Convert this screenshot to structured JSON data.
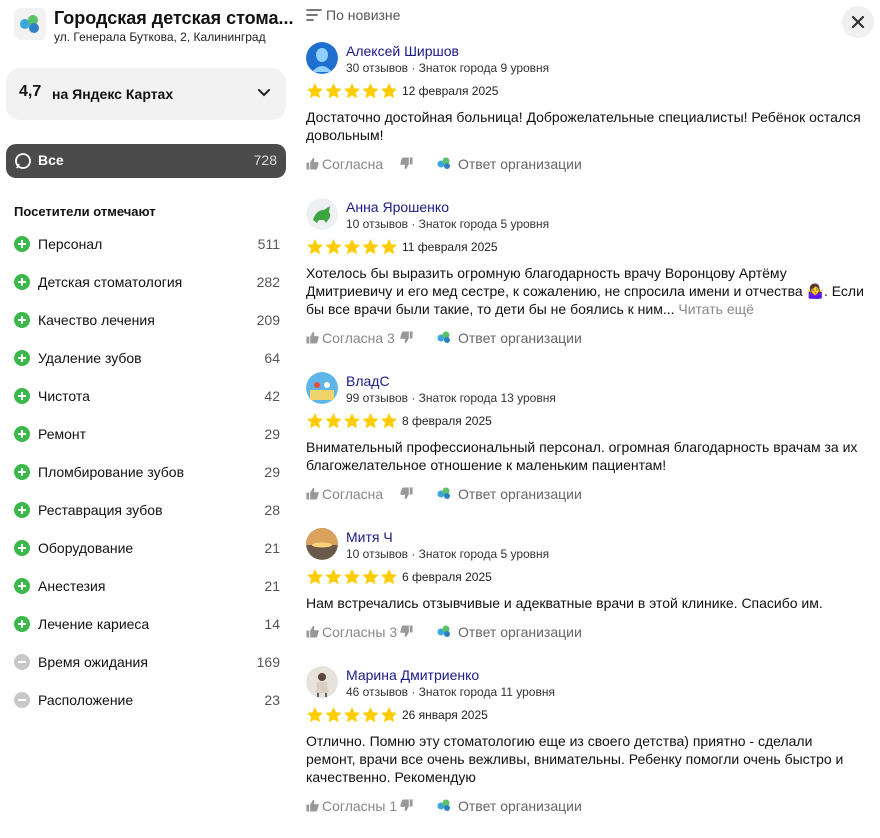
{
  "org": {
    "title": "Городская детская стома...",
    "address": "ул. Генерала Буткова, 2, Калининград"
  },
  "rating": {
    "value": "4,7",
    "source": "на Яндекс Картах"
  },
  "filter_all": {
    "label": "Все",
    "count": "728"
  },
  "visitors_heading": "Посетители отмечают",
  "tags": [
    {
      "label": "Персонал",
      "count": "511",
      "sentiment": "positive"
    },
    {
      "label": "Детская стоматология",
      "count": "282",
      "sentiment": "positive"
    },
    {
      "label": "Качество лечения",
      "count": "209",
      "sentiment": "positive"
    },
    {
      "label": "Удаление зубов",
      "count": "64",
      "sentiment": "positive"
    },
    {
      "label": "Чистота",
      "count": "42",
      "sentiment": "positive"
    },
    {
      "label": "Ремонт",
      "count": "29",
      "sentiment": "positive"
    },
    {
      "label": "Пломбирование зубов",
      "count": "29",
      "sentiment": "positive"
    },
    {
      "label": "Реставрация зубов",
      "count": "28",
      "sentiment": "positive"
    },
    {
      "label": "Оборудование",
      "count": "21",
      "sentiment": "positive"
    },
    {
      "label": "Анестезия",
      "count": "21",
      "sentiment": "positive"
    },
    {
      "label": "Лечение кариеса",
      "count": "14",
      "sentiment": "positive"
    },
    {
      "label": "Время ожидания",
      "count": "169",
      "sentiment": "neutral"
    },
    {
      "label": "Расположение",
      "count": "23",
      "sentiment": "neutral"
    }
  ],
  "sort": {
    "label": "По новизне"
  },
  "reviews": [
    {
      "author": "Алексей Ширшов",
      "meta": "30 отзывов · Знаток города 9 уровня",
      "rating": 5,
      "date": "12 февраля 2025",
      "text_lines": [
        "Достаточно достойная больница! Доброжелательные специалисты! Ребёнок остался",
        "довольным!"
      ],
      "agree": "Согласна",
      "reply": "Ответ организации"
    },
    {
      "author": "Анна Ярошенко",
      "meta": "10 отзывов · Знаток города 5 уровня",
      "rating": 5,
      "date": "11 февраля 2025",
      "text_lines": [
        "Хотелось бы выразить огромную благодарность врачу Воронцову Артёму",
        "Дмитриевичу и его мед сестре, к сожалению, не спросила имени и отчества 🤷‍♀️. Если",
        "бы все врачи были такие, то дети бы не боялись к ним..."
      ],
      "read_more": "Читать ещё",
      "agree": "Согласна 3",
      "reply": "Ответ организации"
    },
    {
      "author": "ВладС",
      "meta": "99 отзывов · Знаток города 13 уровня",
      "rating": 5,
      "date": "8 февраля 2025",
      "text_lines": [
        "Внимательный профессиональный персонал. огромная благодарность врачам за их",
        "благожелательное отношение к маленьким пациентам!"
      ],
      "agree": "Согласна",
      "reply": "Ответ организации"
    },
    {
      "author": "Митя Ч",
      "meta": "10 отзывов · Знаток города 5 уровня",
      "rating": 5,
      "date": "6 февраля 2025",
      "text_lines": [
        "Нам встречались отзывчивые и адекватные врачи в этой клинике. Спасибо им."
      ],
      "agree": "Согласны 3",
      "reply": "Ответ организации"
    },
    {
      "author": "Марина Дмитриенко",
      "meta": "46 отзывов · Знаток города 11 уровня",
      "rating": 5,
      "date": "26 января 2025",
      "text_lines": [
        "Отлично. Помню эту стоматологию еще из своего детства) приятно - сделали",
        "ремонт, врачи все очень вежливы, внимательны. Ребенку помогли очень быстро и",
        "качественно. Рекомендую"
      ],
      "agree": "Согласны 1",
      "reply": "Ответ организации"
    }
  ],
  "colors": {
    "star": "#fc0",
    "positive": "#3bb84a",
    "neutral": "#c8c8c8",
    "pill": "#4b4b4b",
    "author": "#1a1a8a"
  }
}
